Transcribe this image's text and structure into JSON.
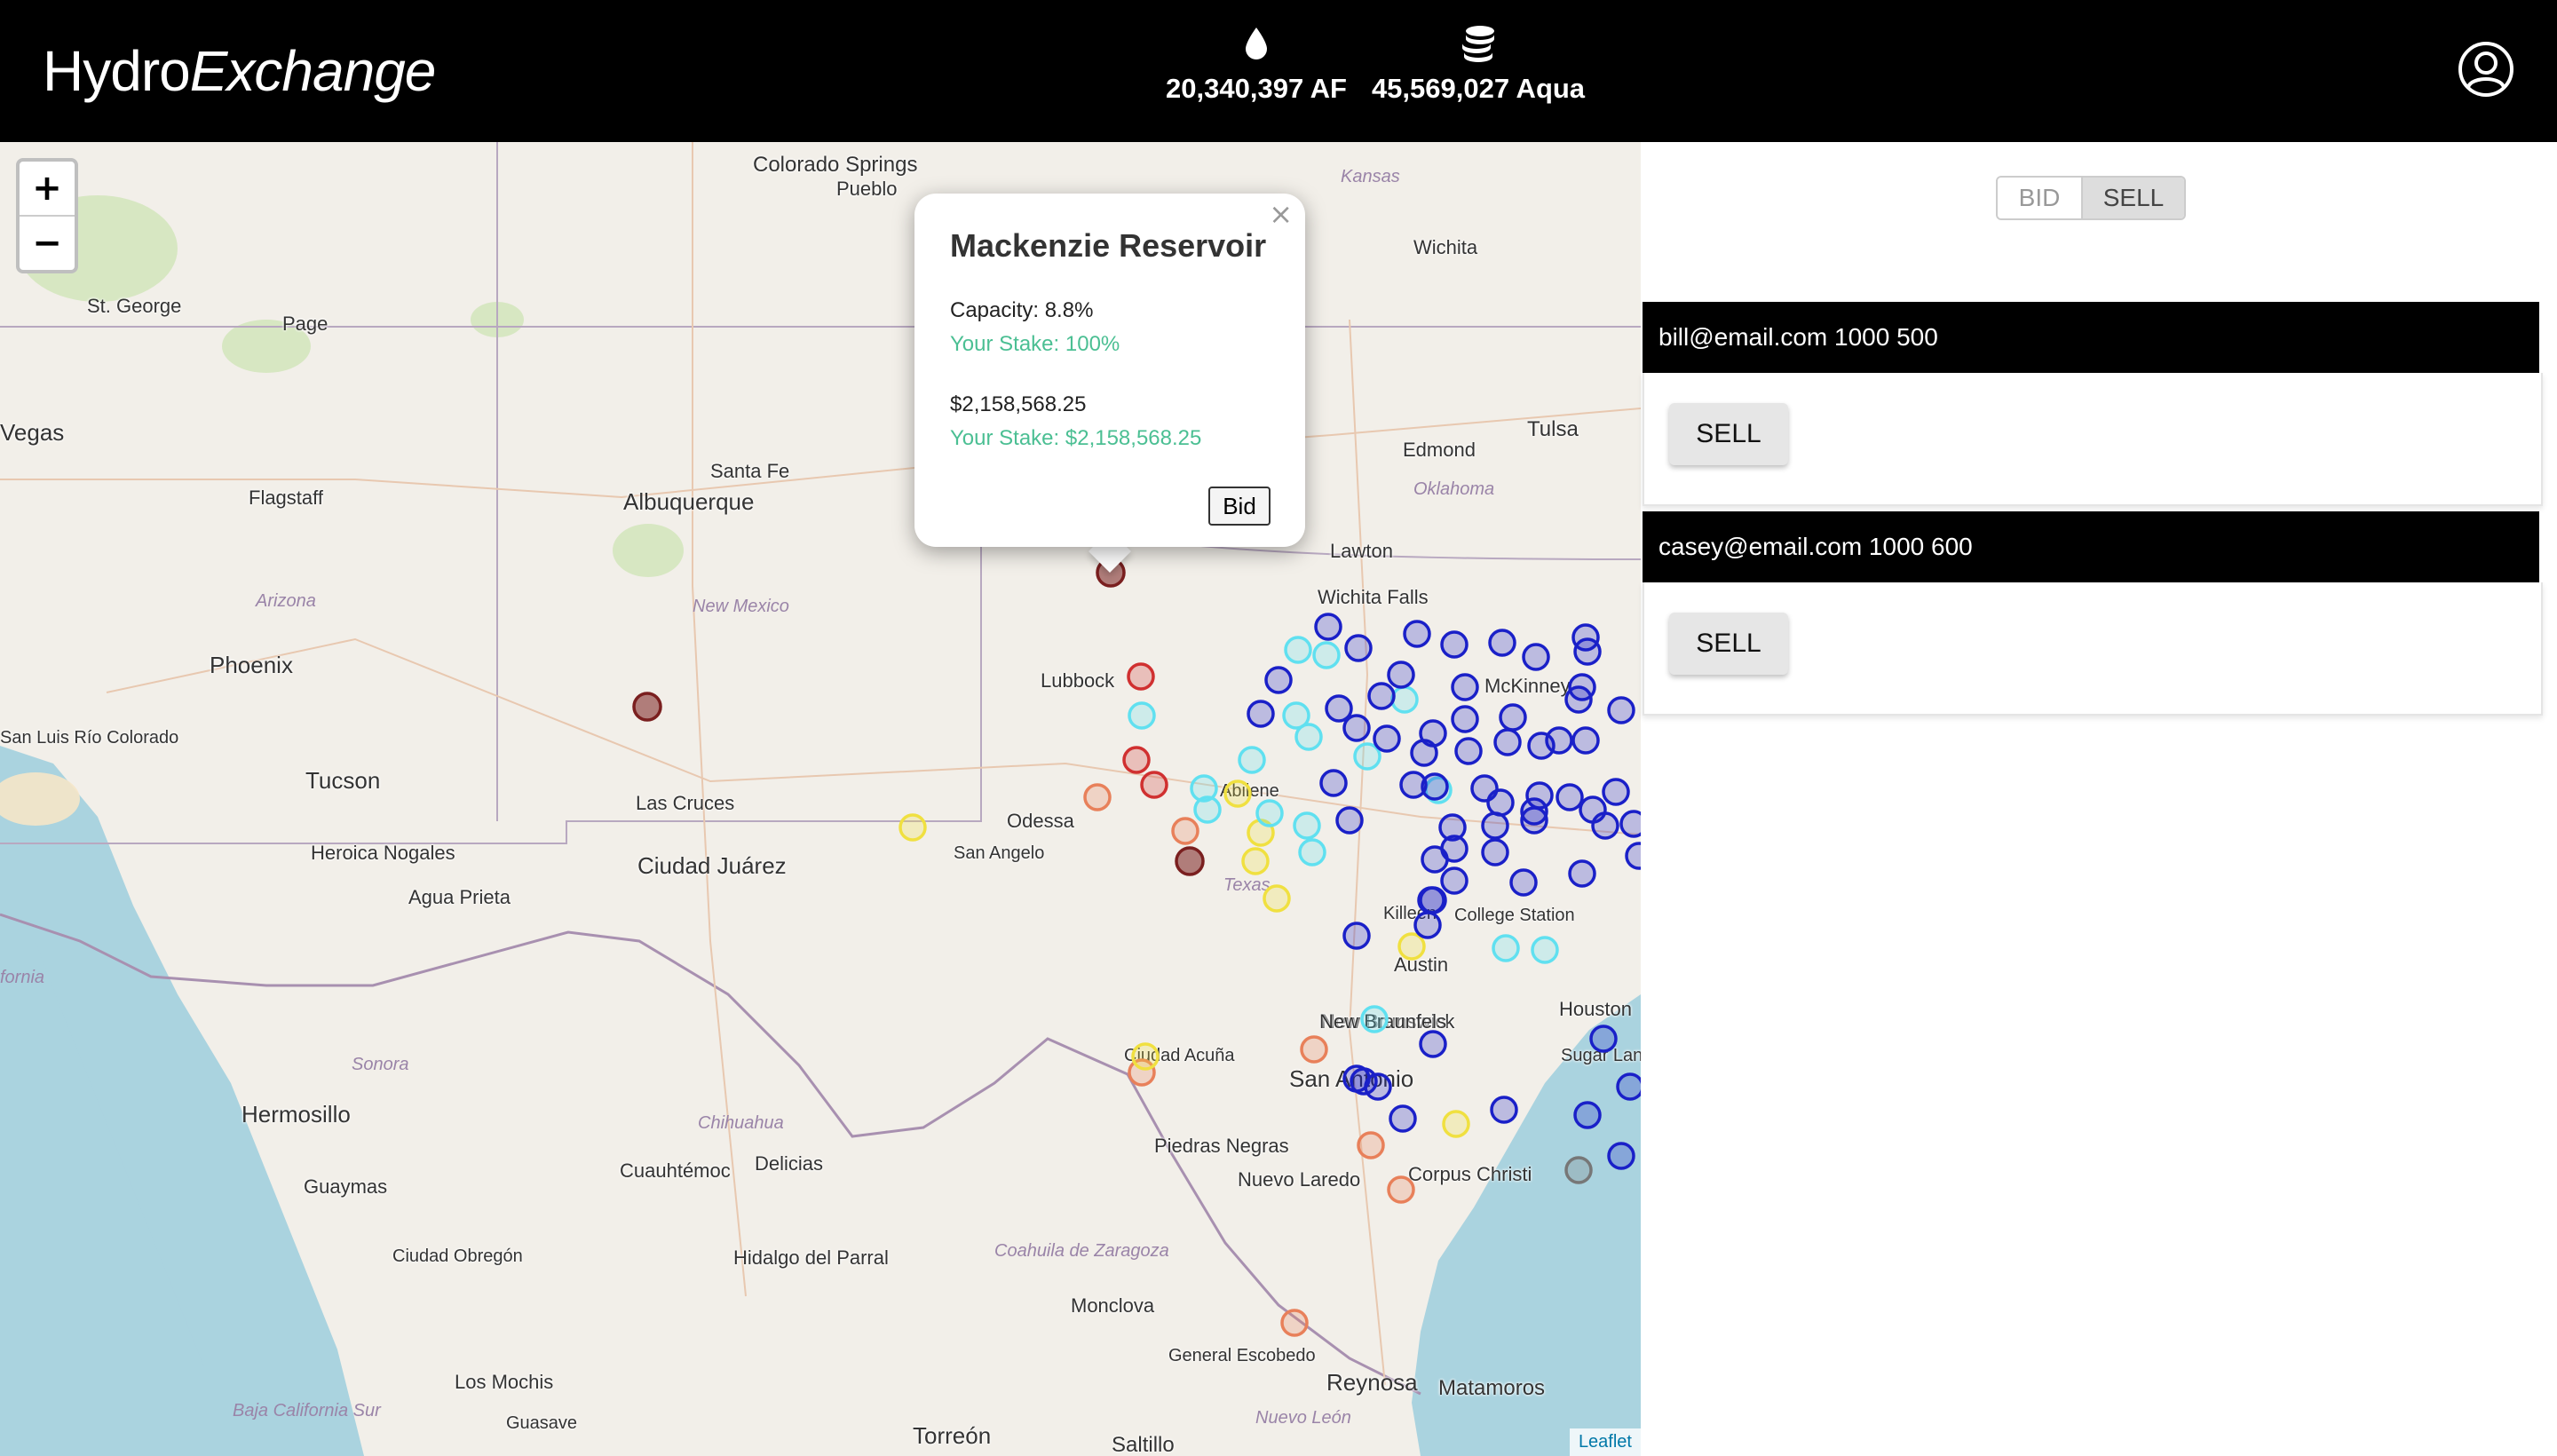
{
  "header": {
    "logo_part1": "Hydro",
    "logo_part2": "Exchange",
    "water_icon": "water-drop-icon",
    "water_total": "20,340,397 AF",
    "coins_icon": "coins-stack-icon",
    "aqua_total": "45,569,027 Aqua",
    "account_icon": "user-circle-icon"
  },
  "map": {
    "zoom_in": "+",
    "zoom_out": "−",
    "attribution": "Leaflet",
    "labels": [
      "Colorado Springs",
      "Pueblo",
      "Kansas",
      "Wichita",
      "St. George",
      "Page",
      "Santa Fe",
      "Albuquerque",
      "Flagstaff",
      "Arizona",
      "New Mexico",
      "Phoenix",
      "Tulsa",
      "Edmond",
      "Oklahoma",
      "Lawton",
      "Wichita Falls",
      "McKinney",
      "Lubbock",
      "Abilene",
      "Odessa",
      "San Angelo",
      "Texas",
      "Tucson",
      "Las Cruces",
      "Ciudad Juárez",
      "Heroica Nogales",
      "Agua Prieta",
      "San Luis Río Colorado",
      "Killeen",
      "College Station",
      "Austin",
      "New Brunswick",
      "New Braunfels",
      "Houston",
      "Sugar Land",
      "San Antonio",
      "Ciudad Acuña",
      "Piedras Negras",
      "Sonora",
      "Hermosillo",
      "Chihuahua",
      "Cuauhtémoc",
      "Delicias",
      "Guaymas",
      "Ciudad Obregón",
      "Hidalgo del Parral",
      "Coahuila de Zaragoza",
      "Monclova",
      "Nuevo Laredo",
      "Corpus Christi",
      "General Escobedo",
      "Reynosa",
      "Matamoros",
      "Los Mochis",
      "Guasave",
      "Torreón",
      "Saltillo",
      "Nuevo León",
      "Baja California Sur",
      "fornia",
      "Vegas"
    ],
    "marker_colors": {
      "dark_red": "#7a1f1f",
      "red": "#d03030",
      "orange": "#e8805a",
      "yellow": "#f0e040",
      "cyan": "#60e0f0",
      "blue": "#1a20c8",
      "gray": "#777777"
    }
  },
  "popup": {
    "close": "×",
    "title": "Mackenzie Reservoir",
    "capacity": "Capacity: 8.8%",
    "stake_pct": "Your Stake: 100%",
    "value": "$2,158,568.25",
    "stake_value": "Your Stake: $2,158,568.25",
    "bid_button": "Bid"
  },
  "panel": {
    "toggle_bid": "BID",
    "toggle_sell": "SELL",
    "orders": [
      {
        "header": "bill@email.com 1000 500",
        "button": "SELL"
      },
      {
        "header": "casey@email.com 1000 600",
        "button": "SELL"
      }
    ]
  }
}
